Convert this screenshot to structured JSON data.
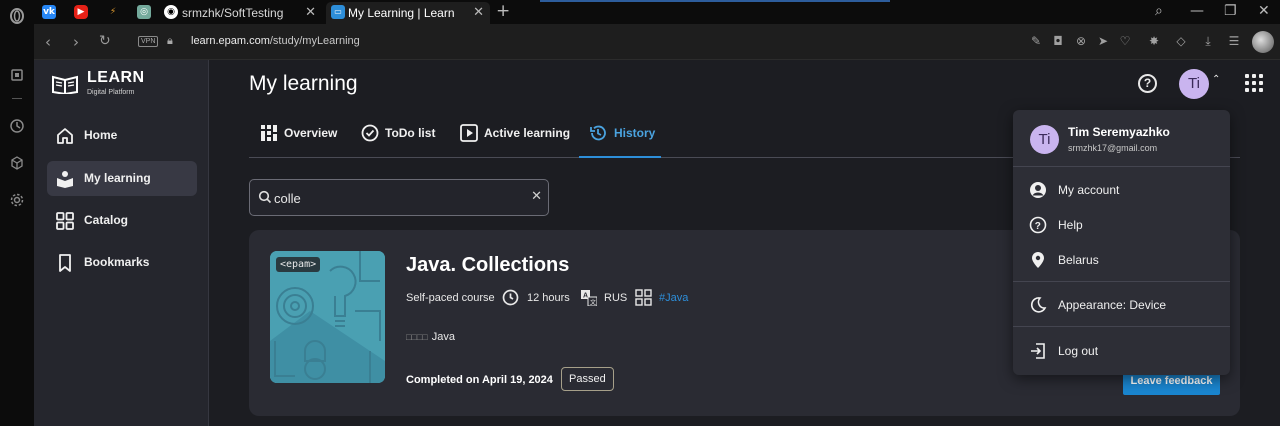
{
  "browser": {
    "tabs": [
      {
        "title": "srmzhk/SoftTesting"
      },
      {
        "title": "My Learning | Learn"
      }
    ],
    "vpn_label": "VPN",
    "url_host": "learn.epam.com",
    "url_path": "/study/myLearning"
  },
  "app": {
    "logo_title": "LEARN",
    "logo_subtitle": "Digital Platform",
    "sidebar": {
      "items": [
        {
          "label": "Home",
          "icon": "home-icon"
        },
        {
          "label": "My learning",
          "icon": "my-learning-icon",
          "active": true
        },
        {
          "label": "Catalog",
          "icon": "catalog-icon"
        },
        {
          "label": "Bookmarks",
          "icon": "bookmark-icon"
        }
      ]
    },
    "page_title": "My learning",
    "avatar_initials": "Ti",
    "tabs": [
      {
        "label": "Overview",
        "icon": "overview-icon"
      },
      {
        "label": "ToDo list",
        "icon": "todo-icon"
      },
      {
        "label": "Active learning",
        "icon": "play-icon"
      },
      {
        "label": "History",
        "icon": "history-icon",
        "active": true
      }
    ],
    "search": {
      "value": "colle"
    },
    "course": {
      "thumb_tag": "<epam>",
      "title": "Java. Collections",
      "type": "Self-paced course",
      "duration": "12 hours",
      "language": "RUS",
      "tag": "#Java",
      "skill_prefix": "□□□□",
      "skill": "Java",
      "completed": "Completed on April 19, 2024",
      "status": "Passed",
      "feedback_label": "Leave feedback"
    },
    "user_menu": {
      "initials": "Ti",
      "name": "Tim Seremyazhko",
      "email": "srmzhk17@gmail.com",
      "items": [
        {
          "label": "My account",
          "icon": "account-icon"
        },
        {
          "label": "Help",
          "icon": "help-icon"
        },
        {
          "label": "Belarus",
          "icon": "location-icon"
        },
        {
          "label": "Appearance: Device",
          "icon": "moon-icon"
        },
        {
          "label": "Log out",
          "icon": "logout-icon"
        }
      ]
    }
  },
  "colors": {
    "accent": "#2d8ed9",
    "avatar": "#c9b4ef",
    "background": "#1c1d22",
    "sidebar": "#25262d"
  }
}
